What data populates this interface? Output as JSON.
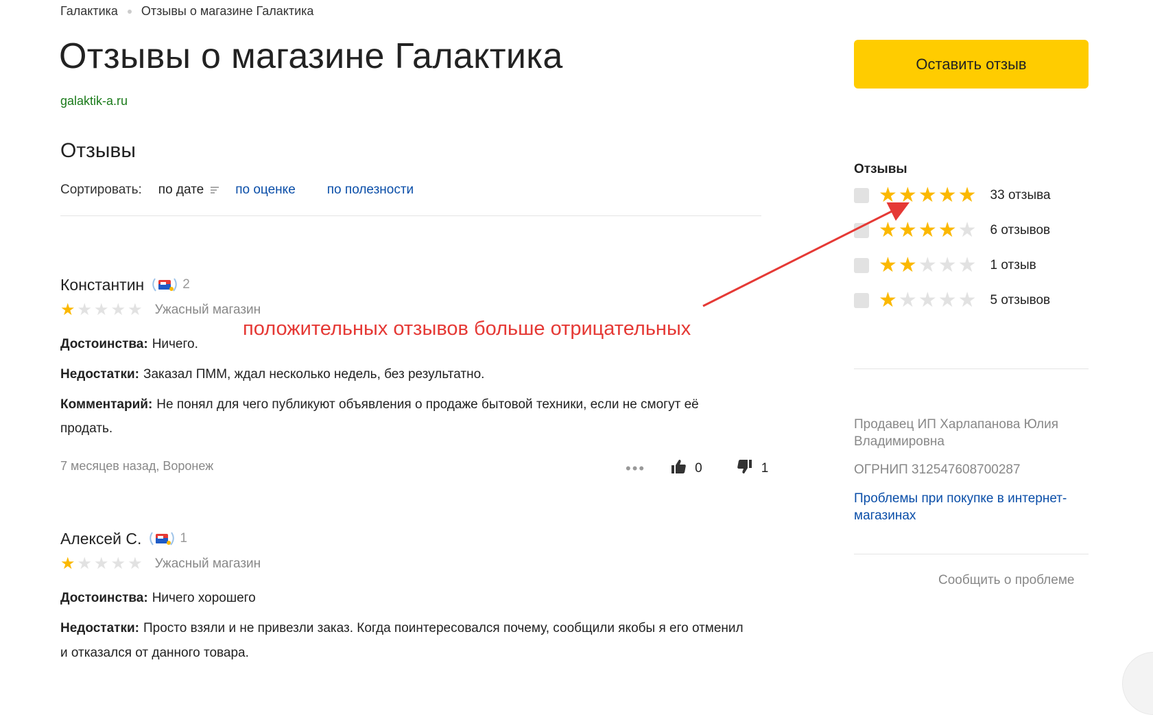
{
  "breadcrumb": {
    "home": "Галактика",
    "current": "Отзывы о магазине Галактика"
  },
  "page": {
    "title": "Отзывы о магазине Галактика",
    "site": "galaktik-a.ru",
    "section_title": "Отзывы"
  },
  "sort": {
    "label": "Сортировать:",
    "by_date": "по дате",
    "by_rating": "по оценке",
    "by_usefulness": "по полезности"
  },
  "reviews": [
    {
      "author": "Константин",
      "badge_count": "2",
      "rating": 1,
      "title": "Ужасный магазин",
      "pros_label": "Достоинства:",
      "pros": "Ничего.",
      "cons_label": "Недостатки:",
      "cons": "Заказал ПММ, ждал несколько недель, без результатно.",
      "comment_label": "Комментарий:",
      "comment": "Не понял для чего публикуют объявления о продаже бытовой техники, если не смогут её продать.",
      "meta": "7 месяцев назад, Воронеж",
      "likes": "0",
      "dislikes": "1"
    },
    {
      "author": "Алексей С.",
      "badge_count": "1",
      "rating": 1,
      "title": "Ужасный магазин",
      "pros_label": "Достоинства:",
      "pros": "Ничего хорошего",
      "cons_label": "Недостатки:",
      "cons": "Просто взяли и не привезли заказ. Когда поинтересовался почему, сообщили якобы я его отменил и отказался от данного товара."
    }
  ],
  "sidebar": {
    "cta": "Оставить отзыв",
    "reviews_title": "Отзывы",
    "filters": [
      {
        "stars": 5,
        "label": "33 отзыва"
      },
      {
        "stars": 4,
        "label": "6 отзывов"
      },
      {
        "stars": 2,
        "label": "1 отзыв"
      },
      {
        "stars": 1,
        "label": "5 отзывов"
      }
    ],
    "seller": "Продавец ИП Харлапанова Юлия Владимировна",
    "ogrnip": "ОГРНИП 312547608700287",
    "problems_link": "Проблемы при покупке в интернет-магазинах",
    "report": "Сообщить о проблеме"
  },
  "annotation": {
    "text": "положительных отзывов больше отрицательных"
  },
  "colors": {
    "accent": "#ffcc00",
    "star_on": "#fbb800",
    "star_off": "#e2e2e2",
    "link": "#0a4ea8",
    "site": "#1a7a1a",
    "annotation": "#e53935"
  },
  "icons": {
    "thumbs_up": "thumbs-up-icon",
    "thumbs_down": "thumbs-down-icon",
    "more": "more-dots-icon",
    "badge": "reviewer-badge-icon"
  }
}
